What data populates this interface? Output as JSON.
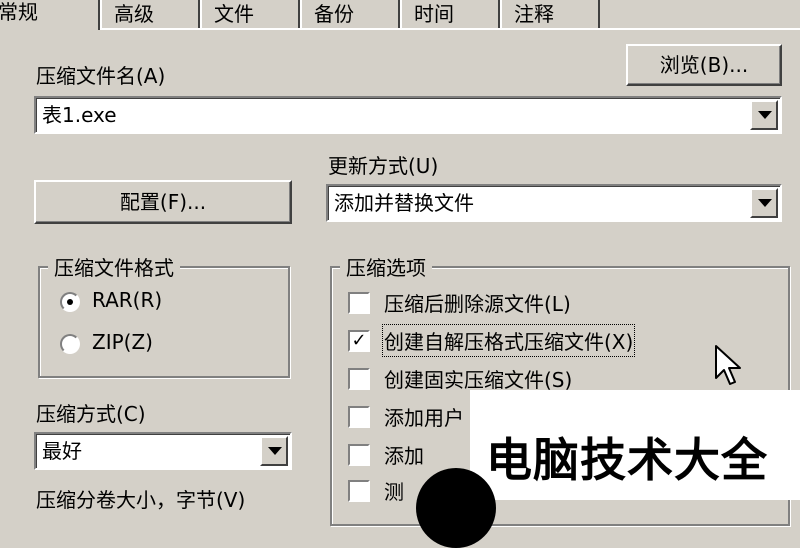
{
  "tabs": [
    "常规",
    "高级",
    "文件",
    "备份",
    "时间",
    "注释"
  ],
  "archive_name": {
    "label": "压缩文件名(A)",
    "value": "表1.exe",
    "browse_button": "浏览(B)..."
  },
  "update_mode": {
    "label": "更新方式(U)",
    "value": "添加并替换文件"
  },
  "config_button": "配置(F)...",
  "archive_format": {
    "title": "压缩文件格式",
    "options": [
      "RAR(R)",
      "ZIP(Z)"
    ],
    "selected": "RAR(R)"
  },
  "compression_method": {
    "label": "压缩方式(C)",
    "value": "最好"
  },
  "split_size_label": "压缩分卷大小，字节(V)",
  "options_group": {
    "title": "压缩选项",
    "items": [
      {
        "label": "压缩后删除源文件(L)",
        "checked": false
      },
      {
        "label": "创建自解压格式压缩文件(X)",
        "checked": true
      },
      {
        "label": "创建固实压缩文件(S)",
        "checked": false
      },
      {
        "label": "添加用户",
        "checked": false
      },
      {
        "label": "添加",
        "checked": false
      },
      {
        "label": "测",
        "checked": false
      }
    ]
  },
  "watermark": "电脑技术大全",
  "colors": {
    "dialog_bg": "#d4d0c8",
    "field_bg": "#ffffff",
    "shadow": "#808080"
  }
}
